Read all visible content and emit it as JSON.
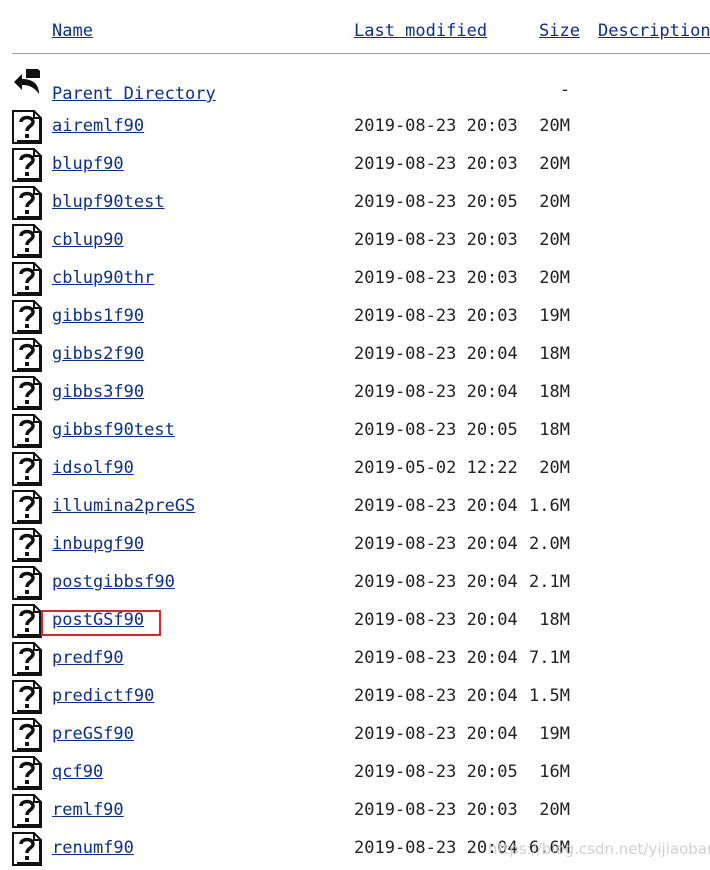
{
  "header": {
    "name": "Name",
    "last_modified": "Last modified",
    "size": "Size",
    "description": "Description"
  },
  "parent": {
    "label": "Parent Directory",
    "size": "-",
    "icon": "back-arrow-icon"
  },
  "files": [
    {
      "name": "airemlf90",
      "modified": "2019-08-23 20:03",
      "size": "20M"
    },
    {
      "name": "blupf90",
      "modified": "2019-08-23 20:03",
      "size": "20M"
    },
    {
      "name": "blupf90test",
      "modified": "2019-08-23 20:05",
      "size": "20M"
    },
    {
      "name": "cblup90",
      "modified": "2019-08-23 20:03",
      "size": "20M"
    },
    {
      "name": "cblup90thr",
      "modified": "2019-08-23 20:03",
      "size": "20M"
    },
    {
      "name": "gibbs1f90",
      "modified": "2019-08-23 20:03",
      "size": "19M"
    },
    {
      "name": "gibbs2f90",
      "modified": "2019-08-23 20:04",
      "size": "18M"
    },
    {
      "name": "gibbs3f90",
      "modified": "2019-08-23 20:04",
      "size": "18M"
    },
    {
      "name": "gibbsf90test",
      "modified": "2019-08-23 20:05",
      "size": "18M"
    },
    {
      "name": "idsolf90",
      "modified": "2019-05-02 12:22",
      "size": "20M"
    },
    {
      "name": "illumina2preGS",
      "modified": "2019-08-23 20:04",
      "size": "1.6M"
    },
    {
      "name": "inbupgf90",
      "modified": "2019-08-23 20:04",
      "size": "2.0M"
    },
    {
      "name": "postgibbsf90",
      "modified": "2019-08-23 20:04",
      "size": "2.1M"
    },
    {
      "name": "postGSf90",
      "modified": "2019-08-23 20:04",
      "size": "18M"
    },
    {
      "name": "predf90",
      "modified": "2019-08-23 20:04",
      "size": "7.1M"
    },
    {
      "name": "predictf90",
      "modified": "2019-08-23 20:04",
      "size": "1.5M"
    },
    {
      "name": "preGSf90",
      "modified": "2019-08-23 20:04",
      "size": "19M"
    },
    {
      "name": "qcf90",
      "modified": "2019-08-23 20:05",
      "size": "16M"
    },
    {
      "name": "remlf90",
      "modified": "2019-08-23 20:03",
      "size": "20M"
    },
    {
      "name": "renumf90",
      "modified": "2019-08-23 20:04",
      "size": "6.6M"
    }
  ],
  "file_icon": "unknown-file-icon",
  "highlighted_file": "postGSf90",
  "highlight_color": "#d42a2a",
  "link_color": "#0b2f8a",
  "watermark": "https://blog.csdn.net/yijiaobani"
}
